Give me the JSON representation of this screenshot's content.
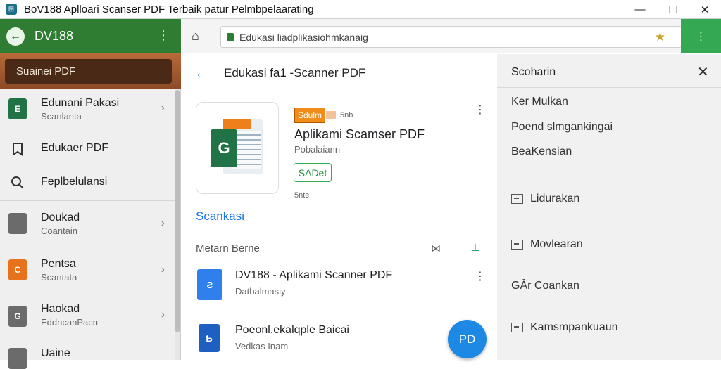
{
  "window": {
    "title": "BoV188 Aplloari Scanser PDF Terbaik patur Pelmbpelaarating",
    "icon": "app-icon",
    "controls": {
      "minimize": "—",
      "maximize": "☐",
      "close": "✕"
    }
  },
  "left_toolbar": {
    "title": "DV188",
    "back_icon": "←",
    "menu_icon": "⋮"
  },
  "search_pill": {
    "label": "Suainei PDF"
  },
  "sidebar": {
    "items": [
      {
        "title": "Edunani Pakasi",
        "sub": "Scanlanta",
        "icon_label": "E",
        "icon_color": "#217346",
        "chev": "›"
      },
      {
        "title": "Edukaer PDF",
        "sub": "",
        "icon_label": "",
        "icon_color": "",
        "chev": ""
      },
      {
        "title": "Feplbelulansi",
        "sub": "",
        "icon_label": "",
        "icon_color": "",
        "chev": ""
      },
      {
        "title": "Doukad",
        "sub": "Coantain",
        "icon_label": "",
        "icon_color": "#6b6b6b",
        "chev": "›"
      },
      {
        "title": "Pentsa",
        "sub": "Scantata",
        "icon_label": "C",
        "icon_color": "#e8711c",
        "chev": "›"
      },
      {
        "title": "Haokad",
        "sub": "EddncanPacn",
        "icon_label": "G",
        "icon_color": "#6b6b6b",
        "chev": "›"
      },
      {
        "title": "Uaine",
        "sub": "",
        "icon_label": "",
        "icon_color": "#6b6b6b",
        "chev": ""
      }
    ]
  },
  "address_bar": {
    "url": "Edukasi liadplikasiohmkanaig",
    "home_icon": "⌂",
    "star_icon": "★",
    "edge_icon": "⋮"
  },
  "main": {
    "back_icon": "←",
    "title": "Edukasi fa1 -Scanner PDF",
    "app": {
      "badge": "Sdulm",
      "badge_tail": "5nb",
      "name": "Aplikami Scamser PDF",
      "developer": "Pobalaiann",
      "install_label": "SADet",
      "note": "5nte",
      "card_icon_letter": "G"
    },
    "link": "Scankasi",
    "section": {
      "title": "Metarn Berne",
      "icon1": "⋈",
      "icon2": "⊥"
    },
    "results": [
      {
        "title": "DV188 - Aplikami Scanner PDF",
        "sub": "Datbalmasiy",
        "icon_letter": "Ƨ"
      },
      {
        "title": "Poeonl.ekalqple Baicai",
        "sub": "Vedkas Inam",
        "icon_letter": "Ƅ"
      }
    ],
    "fab_label": "PD"
  },
  "right_panel": {
    "title": "Scoharin",
    "close_icon": "✕",
    "items": [
      {
        "label": "Ker Mulkan",
        "box": false
      },
      {
        "label": "Poend slmgankingai",
        "box": false
      },
      {
        "label": "BeaKensian",
        "box": false
      },
      {
        "label": "Lidurakan",
        "box": true
      },
      {
        "label": "Movlearan",
        "box": true
      },
      {
        "label": "GẢr Coankan",
        "box": false
      },
      {
        "label": "Kamsmpankuaun",
        "box": true
      }
    ]
  },
  "colors": {
    "toolbar_green": "#2e7d32",
    "brown_band": "#a0522d",
    "link_blue": "#1a73e8",
    "fab_blue": "#1e88e5",
    "install_green": "#34a853",
    "badge_orange": "#f08c1a"
  }
}
